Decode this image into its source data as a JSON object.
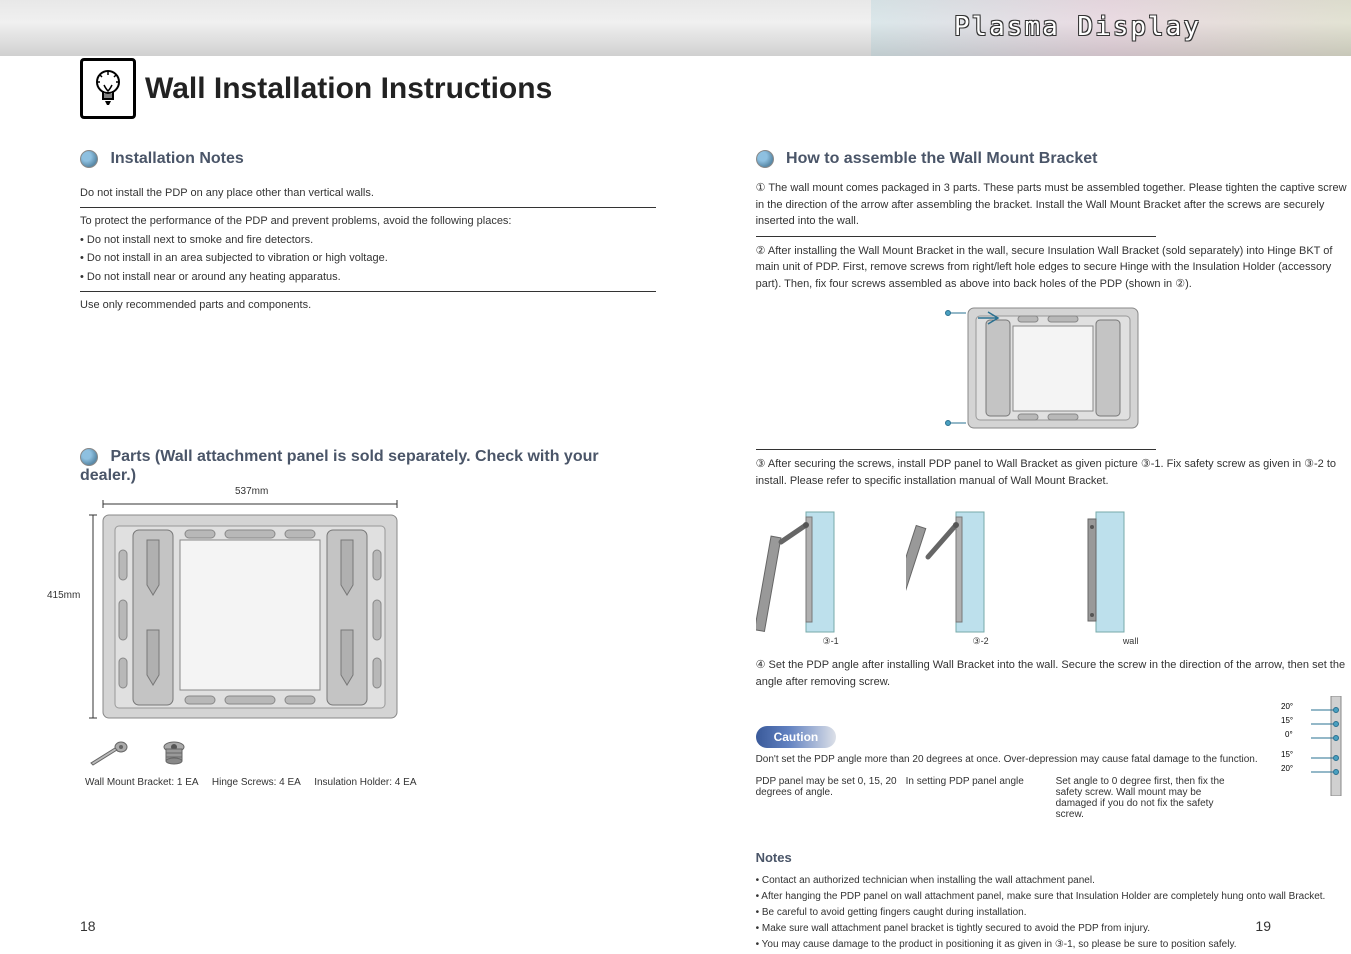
{
  "header": {
    "title": "Plasma Display"
  },
  "main_title": "Wall Installation Instructions",
  "instructions_section": {
    "title": "Installation Notes",
    "notes": [
      "Do not install the PDP on any place other than vertical walls.",
      "To protect the performance of the PDP and prevent problems, avoid the following places:",
      "• Do not install next to smoke and fire detectors.",
      "• Do not install in an area subjected to vibration or high voltage.",
      "• Do not install near or around any heating apparatus.",
      "Use only recommended parts and components."
    ]
  },
  "parts_section": {
    "title": "Parts (Wall attachment panel is sold separately. Check with your dealer.)",
    "dim_w": "537mm",
    "dim_h": "415mm",
    "parts": [
      "Wall Mount Bracket: 1 EA",
      "Hinge Screws: 4 EA",
      "Insulation Holder: 4 EA"
    ]
  },
  "assembly_section": {
    "title": "How to assemble the Wall Mount Bracket",
    "step1_num": "①",
    "step1_text": "The wall mount comes packaged in 3 parts. These parts must be assembled together. Please tighten the captive screw in the direction of the arrow after assembling the bracket. Install the Wall Mount Bracket after the screws are securely inserted into the wall.",
    "step2_num": "②",
    "step2_text": "After installing the Wall Mount Bracket in the wall, secure Insulation Wall Bracket (sold separately) into Hinge BKT of main unit of PDP. First, remove screws from right/left hole edges to secure Hinge with the Insulation Holder (accessory part). Then, fix four screws assembled as above into back holes of the PDP (shown in ②).",
    "step3_num": "③",
    "step3_text": "After securing the screws, install PDP panel to Wall Bracket as given picture ③-1. Fix safety screw as given in ③-2 to install. Please refer to specific installation manual of Wall Mount Bracket.",
    "step4_num": "④",
    "step4_text": "Set the PDP angle after installing Wall Bracket into the wall. Secure the screw in the direction of the arrow, then set the angle after removing screw.",
    "fig3_1": "③-1",
    "fig3_2": "③-2",
    "fig3_3": "wall"
  },
  "caution": {
    "label": "Caution",
    "text": "Don't set the PDP angle more than 20 degrees at once. Over-depression may cause fatal damage to the function."
  },
  "angle_diagram": {
    "a1": "PDP panel may be set 0, 15, 20 degrees of angle.",
    "a2": "In setting PDP panel angle",
    "a3": "Set angle to 0 degree first, then fix the safety screw. Wall mount may be damaged if you do not fix the safety screw.",
    "holes": [
      "20°",
      "15°",
      "0°",
      "15°",
      "20°"
    ]
  },
  "notes_box": {
    "title": "Notes",
    "n1": "• Contact an authorized technician when installing the wall attachment panel.",
    "n2": "• After hanging the PDP panel on wall attachment panel, make sure that Insulation Holder are completely hung onto wall Bracket.",
    "n3": "• Be careful to avoid getting fingers caught during installation.",
    "n4": "• Make sure wall attachment panel bracket is tightly secured to avoid the PDP from injury.",
    "n5": "• You may cause damage to the product in positioning it as given in ③-1, so please be sure to position safely."
  },
  "page_left": "18",
  "page_right": "19"
}
